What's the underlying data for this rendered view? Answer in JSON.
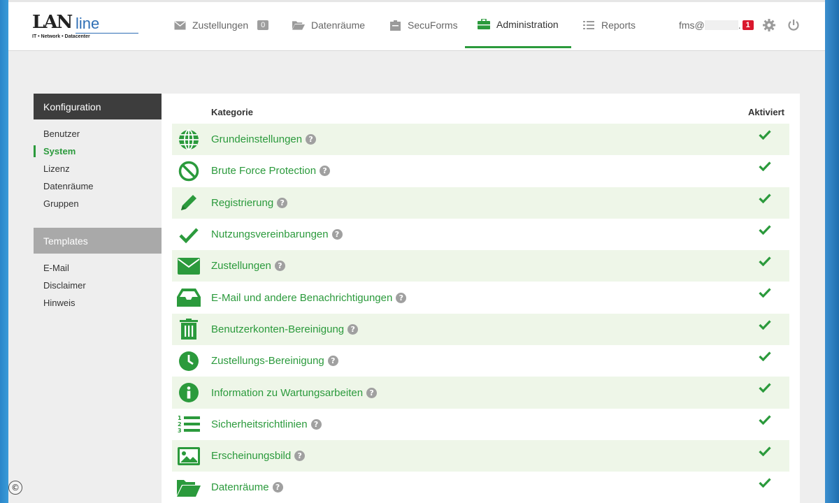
{
  "logo": {
    "main": "LAN",
    "script": "line",
    "tagline": "IT • Network • Datacenter"
  },
  "nav": {
    "items": [
      {
        "label": "Zustellungen",
        "icon": "envelope-icon",
        "badge": "0"
      },
      {
        "label": "Datenräume",
        "icon": "folder-open-icon"
      },
      {
        "label": "SecuForms",
        "icon": "form-icon"
      },
      {
        "label": "Administration",
        "icon": "briefcase-icon",
        "active": true
      },
      {
        "label": "Reports",
        "icon": "list-icon"
      }
    ],
    "user": "fms@",
    "user_suffix": ".",
    "notifications": "1"
  },
  "sidebar": {
    "config_title": "Konfiguration",
    "config_items": [
      {
        "label": "Benutzer"
      },
      {
        "label": "System",
        "active": true
      },
      {
        "label": "Lizenz"
      },
      {
        "label": "Datenräume"
      },
      {
        "label": "Gruppen"
      }
    ],
    "templates_title": "Templates",
    "template_items": [
      {
        "label": "E-Mail"
      },
      {
        "label": "Disclaimer"
      },
      {
        "label": "Hinweis"
      }
    ]
  },
  "table": {
    "col_category": "Kategorie",
    "col_active": "Aktiviert",
    "help_glyph": "?",
    "rows": [
      {
        "label": "Grundeinstellungen",
        "icon": "globe-icon",
        "active": true
      },
      {
        "label": "Brute Force Protection",
        "icon": "ban-icon",
        "active": true
      },
      {
        "label": "Registrierung",
        "icon": "pencil-icon",
        "active": true
      },
      {
        "label": "Nutzungsvereinbarungen",
        "icon": "checkmark-icon",
        "active": true
      },
      {
        "label": "Zustellungen",
        "icon": "envelope-icon",
        "active": true
      },
      {
        "label": "E-Mail und andere Benachrichtigungen",
        "icon": "inbox-icon",
        "active": true
      },
      {
        "label": "Benutzerkonten-Bereinigung",
        "icon": "trash-icon",
        "active": true
      },
      {
        "label": "Zustellungs-Bereinigung",
        "icon": "clock-icon",
        "active": true
      },
      {
        "label": "Information zu Wartungsarbeiten",
        "icon": "info-icon",
        "active": true
      },
      {
        "label": "Sicherheitsrichtlinien",
        "icon": "ordered-list-icon",
        "active": true
      },
      {
        "label": "Erscheinungsbild",
        "icon": "image-icon",
        "active": true
      },
      {
        "label": "Datenräume",
        "icon": "folder-open-icon",
        "active": true
      }
    ]
  },
  "colors": {
    "accent": "#2b9a3c",
    "row_alt": "#eef6e8",
    "sidebar_dark": "#3d3d3d",
    "sidebar_light": "#a9a9a9",
    "badge_red": "#d9182d"
  },
  "copyright_glyph": "©"
}
